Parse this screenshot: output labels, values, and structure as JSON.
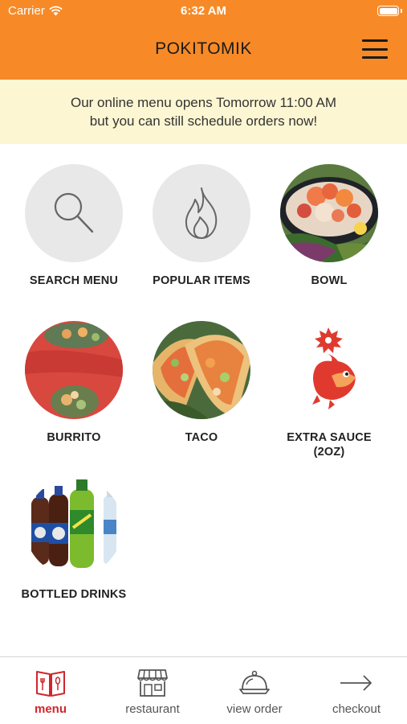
{
  "status_bar": {
    "carrier": "Carrier",
    "time": "6:32 AM"
  },
  "header": {
    "title": "POKITOMIK"
  },
  "banner": {
    "line1": "Our online menu opens Tomorrow 11:00 AM",
    "line2": "but you can still schedule orders now!"
  },
  "tiles": [
    {
      "label": "SEARCH MENU",
      "icon": "search-icon"
    },
    {
      "label": "POPULAR ITEMS",
      "icon": "flame-icon"
    },
    {
      "label": "BOWL"
    },
    {
      "label": "BURRITO"
    },
    {
      "label": "TACO"
    },
    {
      "label": "EXTRA SAUCE",
      "label2": "(2OZ)"
    },
    {
      "label": "BOTTLED DRINKS"
    }
  ],
  "tabs": [
    {
      "label": "menu",
      "icon": "menu-book-icon",
      "active": true
    },
    {
      "label": "restaurant",
      "icon": "storefront-icon"
    },
    {
      "label": "view order",
      "icon": "cloche-icon"
    },
    {
      "label": "checkout",
      "icon": "arrow-right-icon"
    }
  ],
  "colors": {
    "header_bg": "#f78a27",
    "banner_bg": "#fdf6d2",
    "active_tab": "#d0262b"
  }
}
